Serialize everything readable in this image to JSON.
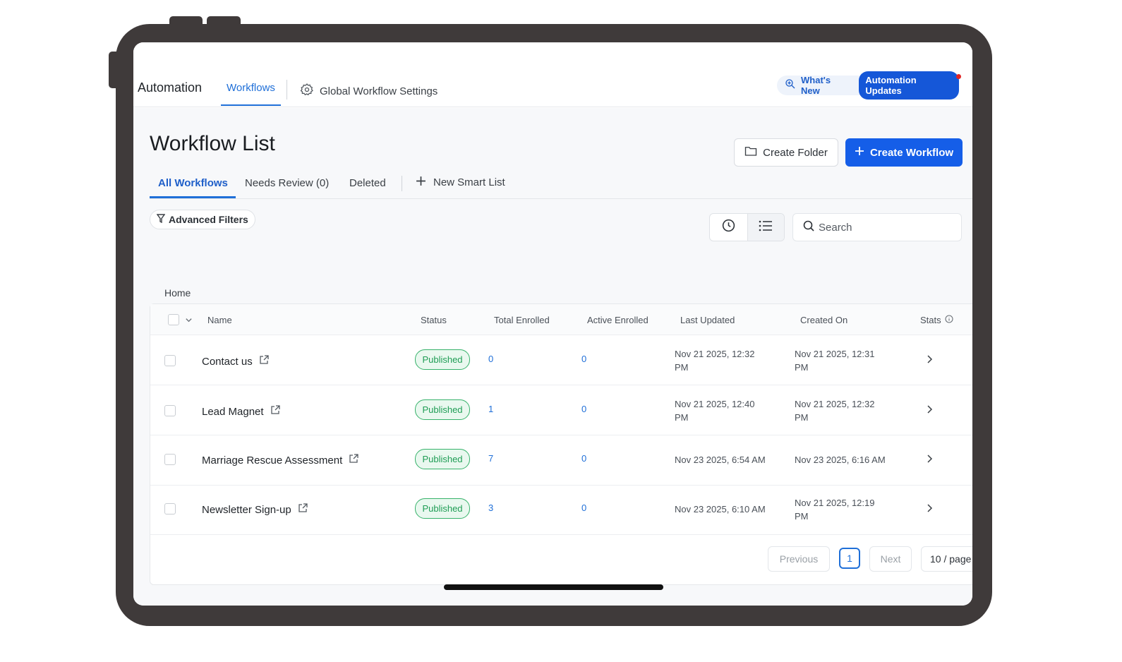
{
  "topnav": {
    "app_title": "Automation",
    "tab_workflows": "Workflows",
    "global_settings": "Global Workflow Settings",
    "whats_new": "What's New",
    "automation_updates": "Automation Updates"
  },
  "page": {
    "title": "Workflow List",
    "create_folder": "Create Folder",
    "create_workflow": "Create Workflow"
  },
  "subtabs": {
    "all": "All Workflows",
    "needs_review": "Needs Review (0)",
    "deleted": "Deleted",
    "new_smart_list": "New Smart List"
  },
  "toolbar": {
    "advanced_filters": "Advanced Filters",
    "search_placeholder": "Search"
  },
  "breadcrumb": "Home",
  "table": {
    "headers": {
      "name": "Name",
      "status": "Status",
      "total_enrolled": "Total Enrolled",
      "active_enrolled": "Active Enrolled",
      "last_updated": "Last Updated",
      "created_on": "Created On",
      "stats": "Stats"
    },
    "rows": [
      {
        "name": "Contact us",
        "status": "Published",
        "total": "0",
        "active": "0",
        "updated_1": "Nov 21 2025, 12:32",
        "updated_2": "PM",
        "created_1": "Nov 21 2025, 12:31",
        "created_2": "PM"
      },
      {
        "name": "Lead Magnet",
        "status": "Published",
        "total": "1",
        "active": "0",
        "updated_1": "Nov 21 2025, 12:40",
        "updated_2": "PM",
        "created_1": "Nov 21 2025, 12:32",
        "created_2": "PM"
      },
      {
        "name": "Marriage Rescue Assessment",
        "status": "Published",
        "total": "7",
        "active": "0",
        "updated_1": "Nov 23 2025, 6:54 AM",
        "updated_2": "",
        "created_1": "Nov 23 2025, 6:16 AM",
        "created_2": ""
      },
      {
        "name": "Newsletter Sign-up",
        "status": "Published",
        "total": "3",
        "active": "0",
        "updated_1": "Nov 23 2025, 6:10 AM",
        "updated_2": "",
        "created_1": "Nov 21 2025, 12:19",
        "created_2": "PM"
      }
    ]
  },
  "pagination": {
    "previous": "Previous",
    "current_page": "1",
    "next": "Next",
    "page_size": "10 / page"
  },
  "colors": {
    "frame": "#3f3a3a",
    "primary": "#155ee8",
    "link": "#1f6fd8",
    "published_border": "#36b26a",
    "published_text": "#1f9d55"
  }
}
